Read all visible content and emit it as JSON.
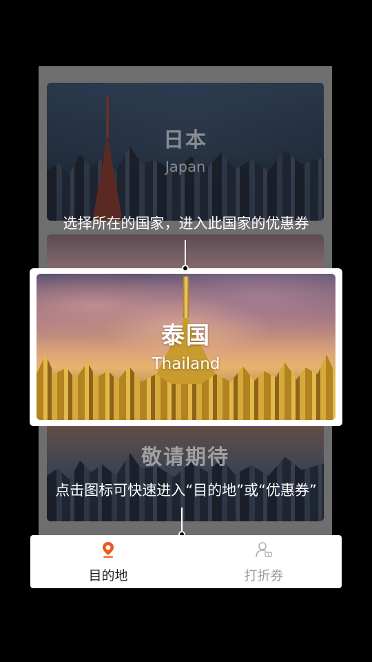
{
  "countries": {
    "japan": {
      "name": "日本",
      "name_en": "Japan"
    },
    "thailand": {
      "name": "泰国",
      "name_en": "Thailand"
    },
    "coming_soon": {
      "name": "敬请期待"
    }
  },
  "hints": {
    "select_country": "选择所在的国家，进入此国家的优惠券",
    "tap_icons": "点击图标可快速进入“目的地”或“优惠券”"
  },
  "tabbar": {
    "destination": {
      "label": "目的地",
      "icon": "location-pin-icon",
      "active": true
    },
    "coupon": {
      "label": "打折券",
      "icon": "user-coupon-icon",
      "active": false
    }
  },
  "colors": {
    "accent": "#f0551e",
    "inactive": "#9a9a9a",
    "overlay": "#000000"
  }
}
